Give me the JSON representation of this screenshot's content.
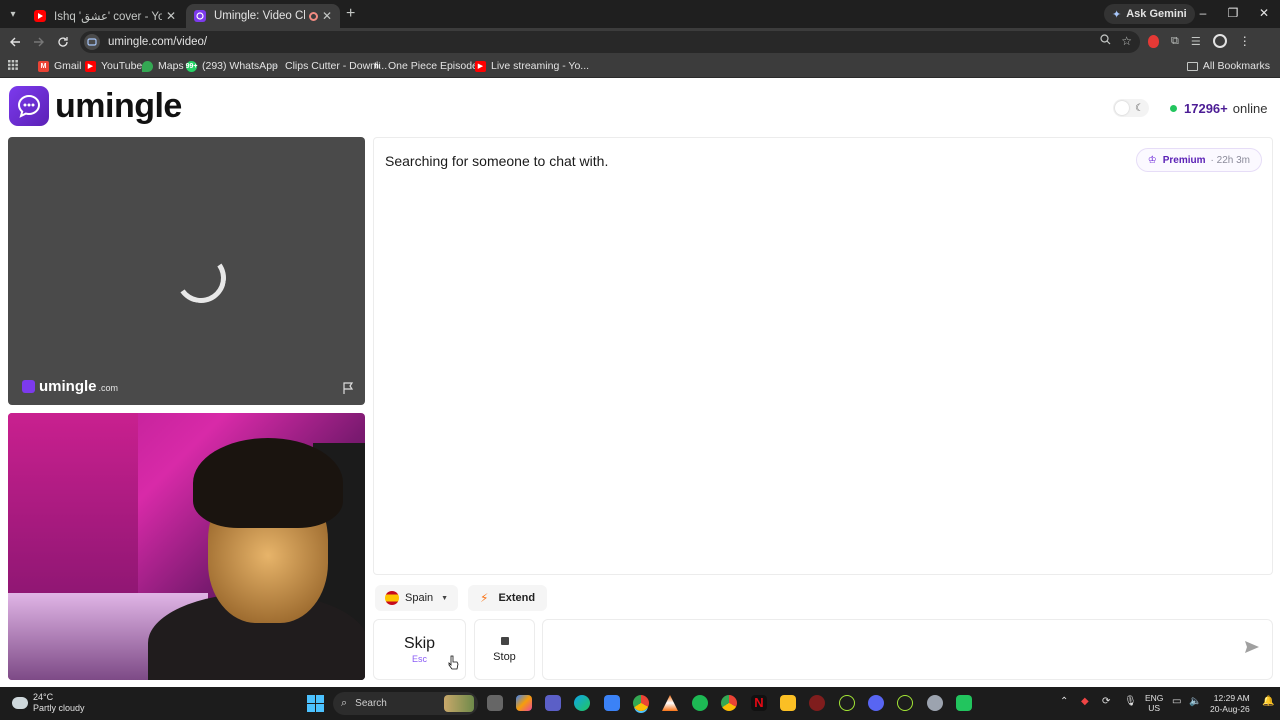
{
  "browser": {
    "tabs": [
      {
        "title": "Ishq 'عشق' cover - YouTube",
        "favicon": "youtube-icon",
        "color": "#ff0000",
        "active": false
      },
      {
        "title": "Umingle: Video Chat with St",
        "favicon": "umingle-icon",
        "color": "#7c3aed",
        "active": true
      }
    ],
    "ask_gemini": "Ask Gemini",
    "url": "umingle.com/video/",
    "bookmarks": [
      {
        "label": "Gmail",
        "icon": "gmail-icon",
        "color": "#ea4335"
      },
      {
        "label": "YouTube",
        "icon": "youtube-icon",
        "color": "#ff0000"
      },
      {
        "label": "Maps",
        "icon": "maps-icon",
        "color": "#34a853"
      },
      {
        "label": "(293) WhatsApp",
        "icon": "whatsapp-icon",
        "color": "#25d366",
        "badge": "99+"
      },
      {
        "label": "Clips Cutter - Downl...",
        "icon": "link-icon",
        "color": "#9aa0a6"
      },
      {
        "label": "One Piece Episode...",
        "icon": "hianime-icon",
        "color": "#444444",
        "badge": "hi"
      },
      {
        "label": "Live streaming - Yo...",
        "icon": "youtube-icon",
        "color": "#ff0000"
      }
    ],
    "all_bookmarks": "All Bookmarks"
  },
  "site": {
    "logo_text": "umingle",
    "online_count": "17296+",
    "online_label": "online",
    "accent": "#5b21b6",
    "status_dot_color": "#22c55e"
  },
  "stranger_video": {
    "watermark": "umingle",
    "watermark_suffix": ".com"
  },
  "chat": {
    "status": "Searching for someone to chat with.",
    "premium_label": "Premium",
    "premium_timer": "22h 3m"
  },
  "controls": {
    "country": "Spain",
    "extend": "Extend",
    "skip": "Skip",
    "skip_hint": "Esc",
    "stop": "Stop",
    "message_placeholder": ""
  },
  "taskbar": {
    "temperature": "24°C",
    "weather": "Partly cloudy",
    "search": "Search",
    "lang_top": "ENG",
    "lang_bottom": "US",
    "time": "12:29 AM",
    "date": "20-Aug-26"
  }
}
